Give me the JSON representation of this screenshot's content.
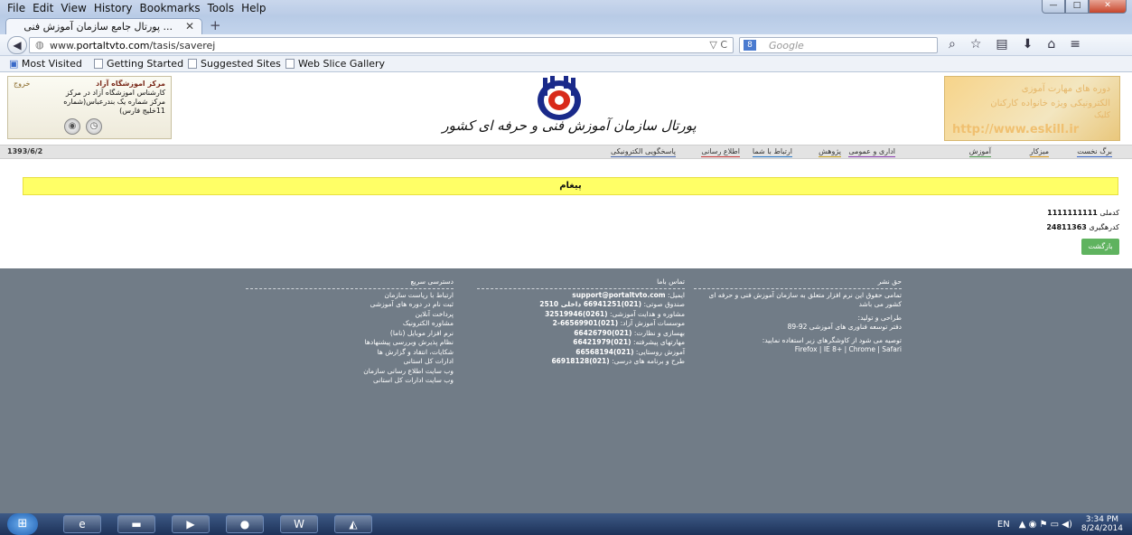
{
  "window": {
    "menus": [
      "File",
      "Edit",
      "View",
      "History",
      "Bookmarks",
      "Tools",
      "Help"
    ],
    "controls": {
      "minimize": "—",
      "maximize": "□",
      "close": "✕"
    },
    "tab_title": "... پورتال جامع سازمان آموزش فنی",
    "tab_close": "✕",
    "new_tab": "+"
  },
  "navbar": {
    "url_prefix": "www.",
    "url_domain": "portaltvto.com",
    "url_path": "/tasis/saverej",
    "url_icons": "▽ C",
    "search_engine": "8",
    "search_placeholder": "Google"
  },
  "bookmarks": {
    "items": [
      "Most Visited",
      "Getting Started",
      "Suggested Sites",
      "Web Slice Gallery"
    ]
  },
  "header": {
    "logout": "خروج",
    "center_name": "مرکز اموزشگاه آزاد",
    "user_line1": "کارشناس اموزشگاه آزاد در مرکز",
    "user_line2": "مرکز شماره یک بندرعباس(شماره",
    "user_line3": "11خلیج فارس)",
    "site_title": "پورتال سازمان آموزش فنی و حرفه ای کشور",
    "ad_line1": "دوره های مهارت آموزی",
    "ad_line2": "الکترونیکی ویژه خانواده کارکنان",
    "ad_line3": "کلیک",
    "ad_url": "http://www.eskill.ir"
  },
  "navstrip": {
    "date": "1393/6/2",
    "items": [
      {
        "label": "برگ نخست",
        "color": "#3a67c8"
      },
      {
        "label": "میزکار",
        "color": "#d99a1a"
      },
      {
        "label": "آموزش",
        "color": "#4a9a4a"
      },
      {
        "label": "اداری و عمومی",
        "color": "#8a3ab0"
      },
      {
        "label": "پژوهش",
        "color": "#c8a11a"
      },
      {
        "label": "ارتباط با شما",
        "color": "#2a7ac8"
      },
      {
        "label": "اطلاع رسانی",
        "color": "#c83a3a"
      },
      {
        "label": "پاسخگویی الکترونیکی",
        "color": "#4a6ab0"
      }
    ]
  },
  "main": {
    "message_title": "پیغام",
    "national_code_label": "کدملی",
    "national_code_value": "1111111111",
    "tracking_code_label": "کدرهگیری",
    "tracking_code_value": "24811363",
    "back_button": "بازگشت"
  },
  "footer": {
    "rights_heading": "حق نشر",
    "rights_text": "تمامی حقوق این نرم افزار متعلق به سازمان آموزش فنی و حرفه ای کشور می باشد",
    "design_label": "طراحی و تولید:",
    "design_text": "دفتر توسعه فناوری های آموزشی 92-89",
    "browser_note": "توصیه می شود از کاوشگرهای زیر استفاده نمایید:",
    "browsers": "Firefox | IE 8+ | Chrome | Safari",
    "contact_heading": "تماس باما",
    "email_label": "ایمیل:",
    "email": "support@portaltvto.com",
    "contacts": [
      {
        "label": "صندوق صوتی:",
        "value": "(021)66941251 داخلی 2510"
      },
      {
        "label": "مشاوره و هدایت آموزشی:",
        "value": "(0261)32519946"
      },
      {
        "label": "موسسات آموزش آزاد:",
        "value": "(021)66569901-2"
      },
      {
        "label": "بهسازی و نظارت:",
        "value": "(021)66426790"
      },
      {
        "label": "مهارتهای پیشرفته:",
        "value": "(021)66421979"
      },
      {
        "label": "آموزش روستایی:",
        "value": "(021)66568194"
      },
      {
        "label": "طرح و برنامه های درسی:",
        "value": "(021)66918128"
      }
    ],
    "quick_heading": "دسترسی سریع",
    "quick_links": [
      "ارتباط با ریاست سازمان",
      "ثبت نام در دوره های آموزشی",
      "پرداخت آنلاین",
      "مشاوره الکترونیک",
      "نرم افزار موبایل (ناما)",
      "نظام پذیرش وبررسی پیشنهادها",
      "شکایات، انتقاد و گزارش ها",
      "ادارات کل استانی",
      "وب سایت اطلاع رسانی سازمان",
      "وب سایت ادارات کل استانی"
    ]
  },
  "taskbar": {
    "lang": "EN",
    "tray_icons": "▲ ◉ ⚑ ▭ ◀)",
    "time": "3:34 PM",
    "date": "8/24/2014"
  }
}
